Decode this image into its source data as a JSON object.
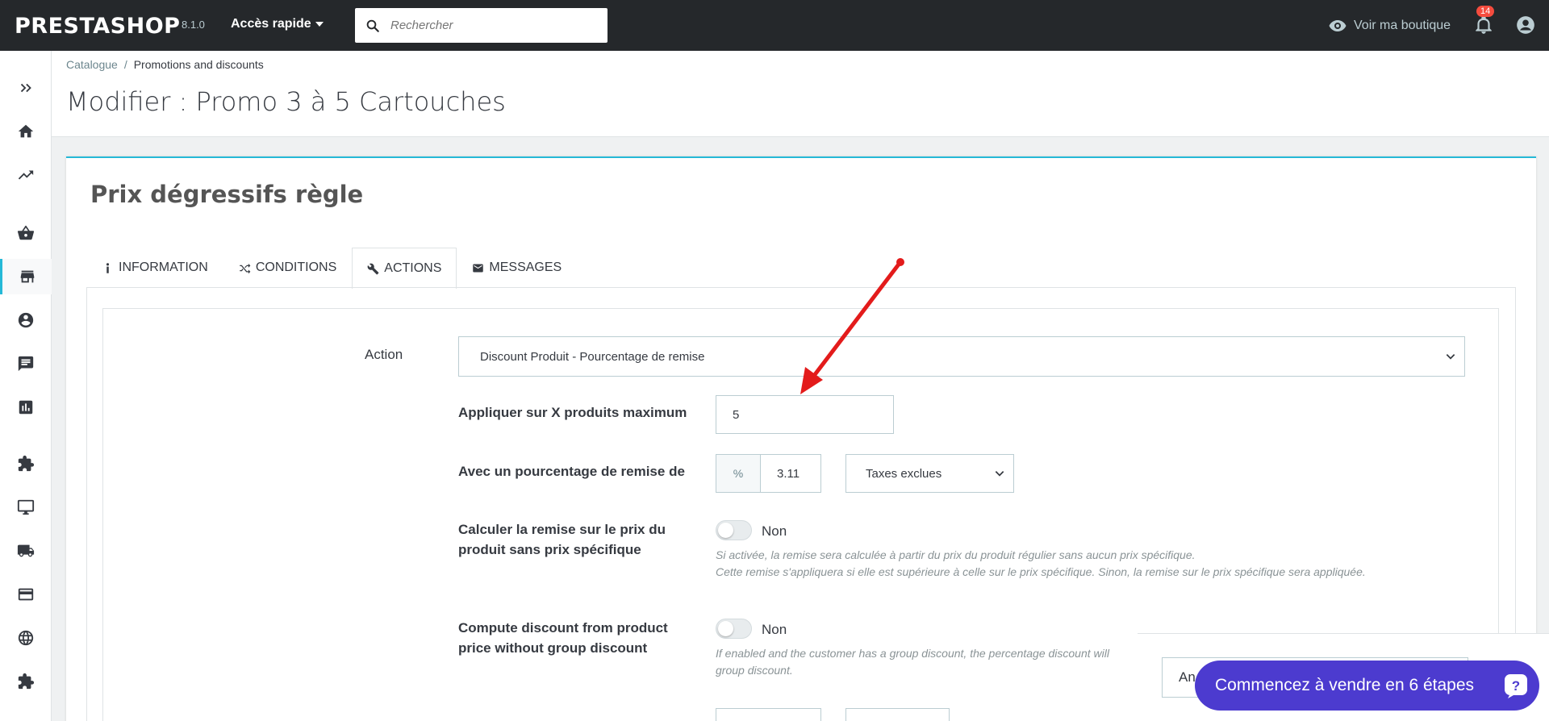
{
  "header": {
    "logo": "PRESTASHOP",
    "version": "8.1.0",
    "quick_access": "Accès rapide",
    "search_placeholder": "Rechercher",
    "view_shop": "Voir ma boutique",
    "notifications_count": "14"
  },
  "breadcrumb": {
    "parent": "Catalogue",
    "separator": "/",
    "current": "Promotions and discounts"
  },
  "page_title": "Modifier : Promo 3 à 5 Cartouches",
  "card": {
    "title": "Prix dégressifs règle",
    "tabs": [
      {
        "label": "Information",
        "icon": "info-icon"
      },
      {
        "label": "Conditions",
        "icon": "shuffle-icon"
      },
      {
        "label": "Actions",
        "icon": "wrench-icon"
      },
      {
        "label": "Messages",
        "icon": "envelope-icon"
      }
    ],
    "active_tab": "Actions"
  },
  "form": {
    "action_label": "Action",
    "action_value": "Discount Produit - Pourcentage de remise",
    "max_products_label": "Appliquer sur X produits maximum",
    "max_products_value": "5",
    "percent_label": "Avec un pourcentage de remise de",
    "percent_addon": "%",
    "percent_value": "3.11",
    "tax_value": "Taxes exclues",
    "specific_price_label_1": "Calculer la remise sur le prix du",
    "specific_price_label_2": "produit sans prix spécifique",
    "specific_price_state": "Non",
    "specific_price_help_1": "Si activée, la remise sera calculée à partir du prix du produit régulier sans aucun prix spécifique.",
    "specific_price_help_2": "Cette remise s'appliquera si elle est supérieure à celle sur le prix spécifique. Sinon, la remise sur le prix spécifique sera appliquée.",
    "group_discount_label_1": "Compute discount from product",
    "group_discount_label_2": "price without group discount",
    "group_discount_state": "Non",
    "group_discount_help_1": "If enabled and the customer has a group discount, the percentage discount will",
    "group_discount_help_2": "group discount."
  },
  "footer": {
    "cancel_partial": "An",
    "cta_label": "Commencez à vendre en 6 étapes"
  },
  "colors": {
    "topbar": "#25282b",
    "accent": "#25b9d7",
    "cta": "#4c3bcf",
    "arrow": "#e31b1b"
  }
}
